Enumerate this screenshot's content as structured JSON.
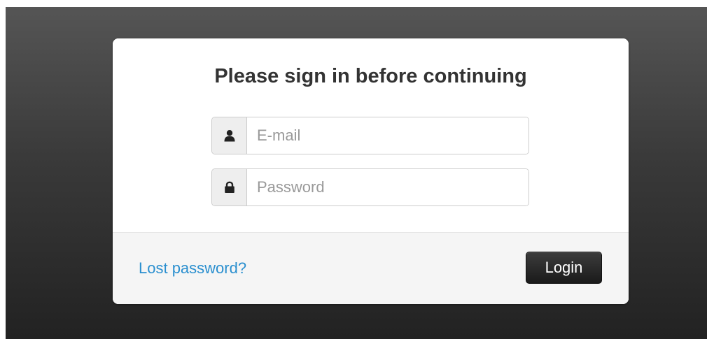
{
  "login": {
    "title": "Please sign in before continuing",
    "email_placeholder": "E-mail",
    "email_value": "",
    "password_placeholder": "Password",
    "password_value": "",
    "lost_password_label": "Lost password?",
    "login_button_label": "Login",
    "user_icon": "user-icon",
    "lock_icon": "lock-icon"
  },
  "colors": {
    "link": "#2a8fcf",
    "button": "#222222",
    "footer_bg": "#f5f5f5"
  }
}
